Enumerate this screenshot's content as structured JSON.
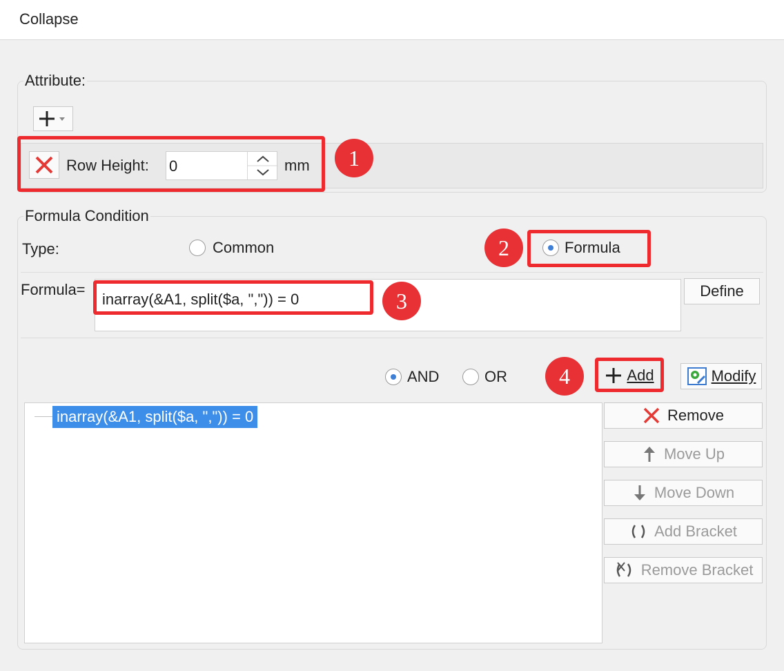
{
  "title": "Collapse",
  "attribute": {
    "legend": "Attribute:",
    "row_height_label": "Row Height:",
    "row_height_value": "0",
    "unit": "mm"
  },
  "condition": {
    "legend": "Formula Condition",
    "type_label": "Type:",
    "type_options": [
      "Common",
      "Formula"
    ],
    "formula_label": "Formula=",
    "formula_value": "inarray(&A1, split($a, \",\")) = 0",
    "define_label": "Define",
    "logic_options": [
      "AND",
      "OR"
    ],
    "add_label": "Add",
    "modify_label": "Modify",
    "tree_items": [
      "inarray(&A1, split($a, \",\")) = 0"
    ],
    "side_buttons": {
      "remove": "Remove",
      "move_up": "Move Up",
      "move_down": "Move Down",
      "add_bracket": "Add Bracket",
      "remove_bracket": "Remove Bracket"
    }
  },
  "callouts": [
    "1",
    "2",
    "3",
    "4"
  ],
  "colors": {
    "callout_red": "#ee2a2e",
    "badge_red": "#e73135",
    "selection_blue": "#3d8ee8",
    "radio_dot": "#3f7fd6"
  },
  "icons": {
    "add_dropdown": "plus-dropdown-icon",
    "delete": "red-x-icon",
    "spinner": "chevron-up-down-icon",
    "add": "plus-icon",
    "modify": "gear-edit-icon",
    "remove": "red-x-icon",
    "move_up": "arrow-up-icon",
    "move_down": "arrow-down-icon",
    "add_bracket": "brackets-icon",
    "remove_bracket": "remove-brackets-icon"
  }
}
